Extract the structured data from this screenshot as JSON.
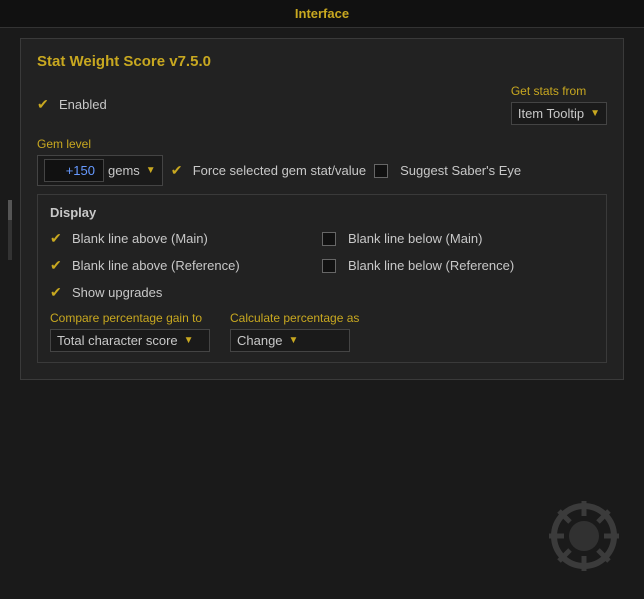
{
  "header": {
    "title": "Interface"
  },
  "panel": {
    "title": "Stat Weight Score v7.5.0",
    "enabled": {
      "label": "Enabled",
      "checked": true
    },
    "get_stats_from": {
      "label": "Get stats from",
      "dropdown_value": "Item Tooltip"
    },
    "gem_level": {
      "label": "Gem level",
      "value": "+150",
      "value_suffix": "gems",
      "force_checkbox_label": "Force selected gem stat/value",
      "force_checked": true,
      "suggest_label": "Suggest Saber's Eye",
      "suggest_checked": false
    },
    "display": {
      "section_label": "Display",
      "items": [
        {
          "label": "Blank line above (Main)",
          "checked": true,
          "id": "blank-above-main"
        },
        {
          "label": "Blank line below (Main)",
          "checked": false,
          "id": "blank-below-main"
        },
        {
          "label": "Blank line above (Reference)",
          "checked": true,
          "id": "blank-above-ref"
        },
        {
          "label": "Blank line below (Reference)",
          "checked": false,
          "id": "blank-below-ref"
        }
      ],
      "show_upgrades": {
        "label": "Show upgrades",
        "checked": true
      }
    },
    "compare": {
      "label": "Compare percentage gain to",
      "dropdown_value": "Total character score",
      "calculate_label": "Calculate percentage as",
      "calculate_value": "Change"
    }
  },
  "icons": {
    "checkmark": "✔",
    "dropdown_arrow": "▼"
  }
}
